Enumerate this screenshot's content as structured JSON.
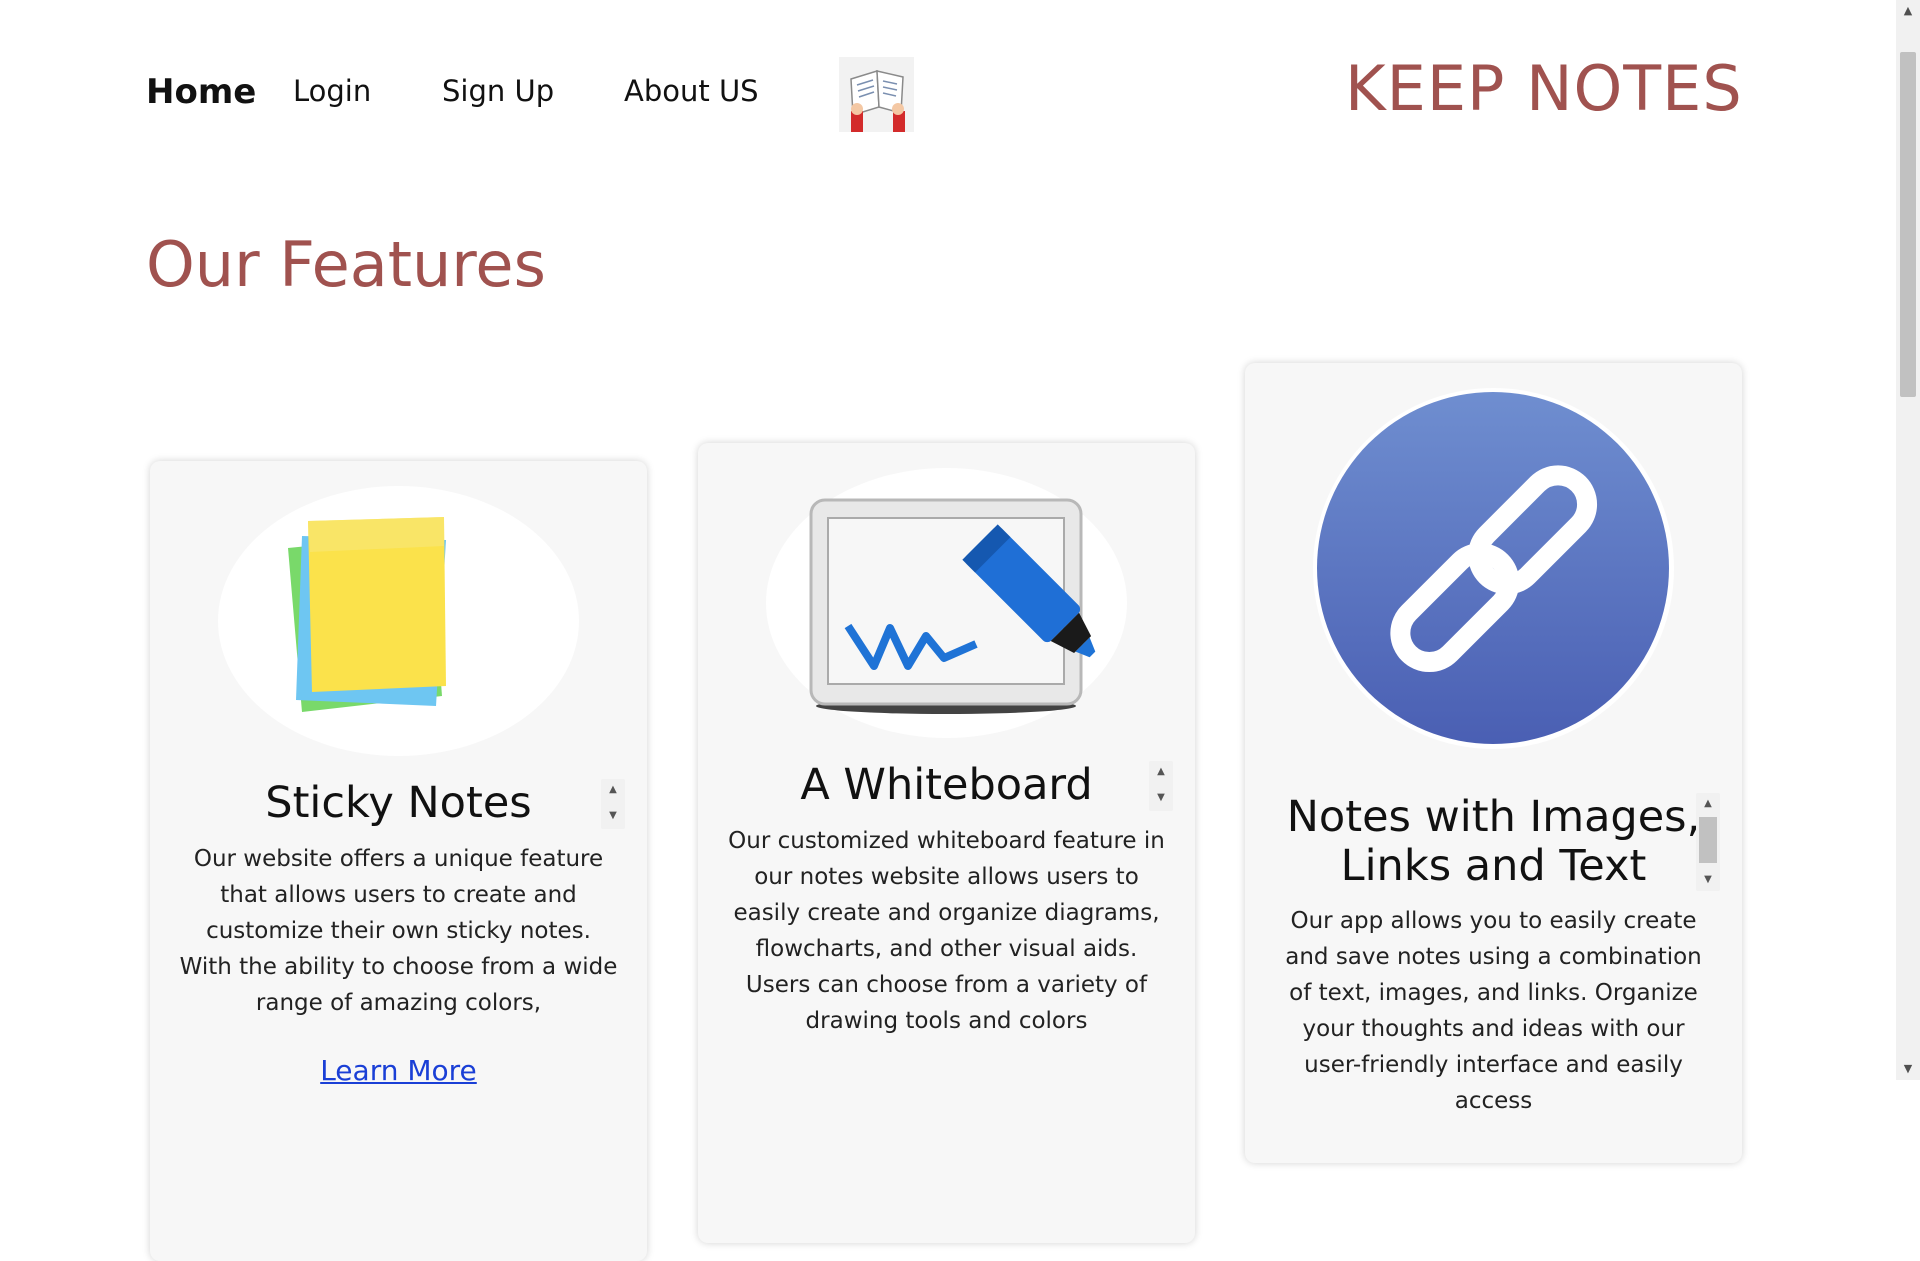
{
  "nav": {
    "home": "Home",
    "login": "Login",
    "signup": "Sign Up",
    "about": "About US"
  },
  "brand": "KEEP NOTES",
  "section_title": "Our Features",
  "cards": [
    {
      "title": "Sticky Notes",
      "description": "Our website offers a unique feature that allows users to create and customize their own sticky notes. With the ability to choose from a wide range of amazing colors,",
      "link": "Learn More"
    },
    {
      "title": "A Whiteboard",
      "description": "Our customized whiteboard feature in our notes website allows users to easily create and organize diagrams, flowcharts, and other visual aids. Users can choose from a variety of drawing tools and colors"
    },
    {
      "title": "Notes with Images, Links and Text",
      "description": "Our app allows you to easily create and save notes using a combination of text, images, and links. Organize your thoughts and ideas with our user-friendly interface and easily access"
    }
  ],
  "colors": {
    "accent": "#a0524f",
    "link": "#1a3fd6",
    "card_bg": "#f7f7f7"
  },
  "icons": [
    "notebook-logo-icon",
    "sticky-notes-icon",
    "whiteboard-icon",
    "link-chain-icon"
  ]
}
